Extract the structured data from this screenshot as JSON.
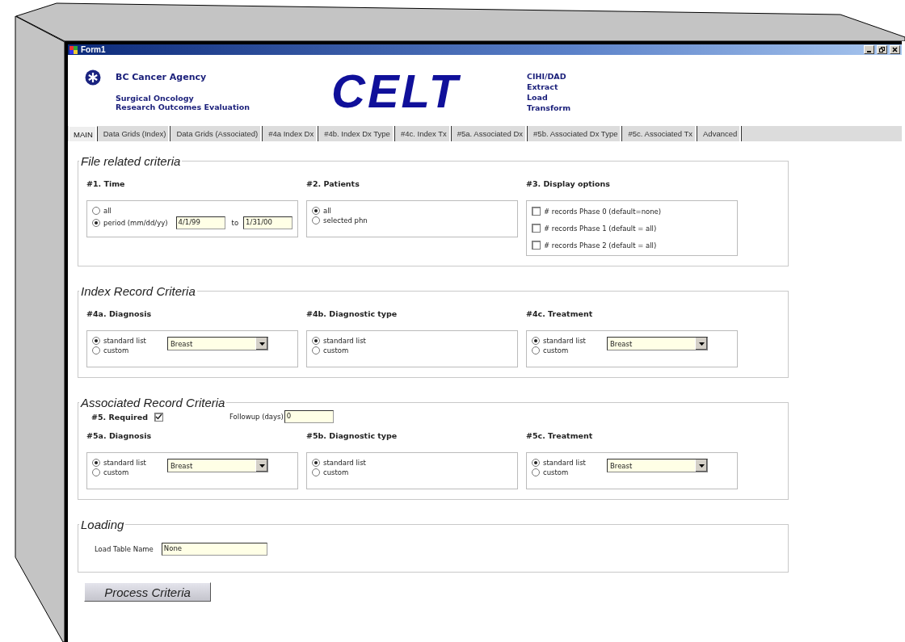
{
  "window": {
    "title": "Form1"
  },
  "header": {
    "org_name": "BC Cancer Agency",
    "department": [
      "Surgical Oncology",
      "Research  Outcomes Evaluation"
    ],
    "app_name": "CELT",
    "app_expansion": [
      "CIHI/DAD",
      "Extract",
      "Load",
      "Transform"
    ]
  },
  "tabs": [
    {
      "label": "MAIN",
      "selected": true
    },
    {
      "label": "Data Grids (Index)",
      "selected": false
    },
    {
      "label": "Data Grids (Associated)",
      "selected": false
    },
    {
      "label": "#4a Index Dx",
      "selected": false
    },
    {
      "label": "#4b. Index Dx Type",
      "selected": false
    },
    {
      "label": "#4c. Index Tx",
      "selected": false
    },
    {
      "label": "#5a. Associated Dx",
      "selected": false
    },
    {
      "label": "#5b. Associated Dx Type",
      "selected": false
    },
    {
      "label": "#5c. Associated Tx",
      "selected": false
    },
    {
      "label": "Advanced",
      "selected": false
    }
  ],
  "sections": [
    {
      "title": "File related criteria",
      "groups": [
        {
          "heading": "#1.  Time",
          "options": [
            {
              "kind": "radio",
              "label": "all",
              "selected": false
            },
            {
              "kind": "radio",
              "label": "period  (mm/dd/yy)",
              "selected": true,
              "fields": [
                {
                  "value": "4/1/99"
                },
                {
                  "label": "to",
                  "value": "1/31/00"
                }
              ]
            }
          ]
        },
        {
          "heading": "#2.  Patients",
          "options": [
            {
              "kind": "radio",
              "label": "all",
              "selected": true
            },
            {
              "kind": "radio",
              "label": "selected phn",
              "selected": false
            }
          ]
        },
        {
          "heading": "#3.  Display options",
          "options": [
            {
              "kind": "checkbox",
              "label": "# records Phase 0 (default=none)",
              "checked": false
            },
            {
              "kind": "checkbox",
              "label": "# records Phase 1 (default = all)",
              "checked": false
            },
            {
              "kind": "checkbox",
              "label": "# records Phase 2 (default = all)",
              "checked": false
            }
          ]
        }
      ]
    },
    {
      "title": "Index Record Criteria",
      "groups": [
        {
          "heading": "#4a.  Diagnosis",
          "options": [
            {
              "kind": "radio",
              "label": "standard list",
              "selected": true
            },
            {
              "kind": "radio",
              "label": "custom",
              "selected": false
            }
          ],
          "dropdown": "Breast"
        },
        {
          "heading": "#4b.  Diagnostic type",
          "options": [
            {
              "kind": "radio",
              "label": "standard list",
              "selected": true
            },
            {
              "kind": "radio",
              "label": "custom",
              "selected": false
            }
          ]
        },
        {
          "heading": "#4c.  Treatment",
          "options": [
            {
              "kind": "radio",
              "label": "standard list",
              "selected": true
            },
            {
              "kind": "radio",
              "label": "custom",
              "selected": false
            }
          ],
          "dropdown": "Breast"
        }
      ]
    },
    {
      "title": "Associated Record Criteria",
      "required": {
        "label": "#5.  Required",
        "checked": true
      },
      "followup": {
        "label": "Followup (days)",
        "value": "0"
      },
      "groups": [
        {
          "heading": "#5a.  Diagnosis",
          "options": [
            {
              "kind": "radio",
              "label": "standard list",
              "selected": true
            },
            {
              "kind": "radio",
              "label": "custom",
              "selected": false
            }
          ],
          "dropdown": "Breast"
        },
        {
          "heading": "#5b.  Diagnostic type",
          "options": [
            {
              "kind": "radio",
              "label": "standard list",
              "selected": true
            },
            {
              "kind": "radio",
              "label": "custom",
              "selected": false
            }
          ]
        },
        {
          "heading": "#5c.  Treatment",
          "options": [
            {
              "kind": "radio",
              "label": "standard list",
              "selected": true
            },
            {
              "kind": "radio",
              "label": "custom",
              "selected": false
            }
          ],
          "dropdown": "Breast"
        }
      ]
    },
    {
      "title": "Loading",
      "fields": [
        {
          "label": "Load Table Name",
          "value": "None"
        }
      ]
    }
  ],
  "process_button": "Process Criteria"
}
